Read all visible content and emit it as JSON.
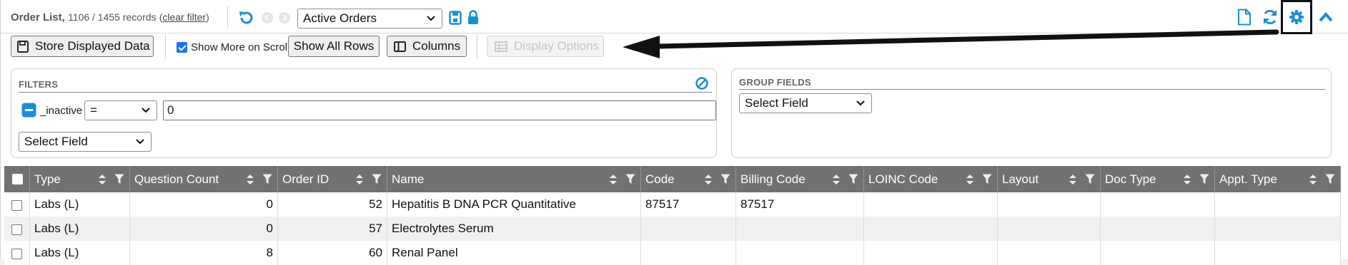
{
  "header": {
    "title": "Order List,",
    "record_count": "1106 / 1455 records",
    "clear_filter_label": "clear filter",
    "saved_view": "Active Orders"
  },
  "toolbar": {
    "store_label": "Store Displayed Data",
    "show_more_label": "Show More on Scroll",
    "show_more_checked": true,
    "show_all_rows_label": "Show All Rows",
    "columns_label": "Columns",
    "display_options_label": "Display Options"
  },
  "filters": {
    "title": "FILTERS",
    "rows": [
      {
        "field": "_inactive",
        "operator": "=",
        "value": "0"
      }
    ],
    "select_field_placeholder": "Select Field"
  },
  "group_fields": {
    "title": "GROUP FIELDS",
    "select_field_placeholder": "Select Field"
  },
  "grid": {
    "columns": [
      "Type",
      "Question Count",
      "Order ID",
      "Name",
      "Code",
      "Billing Code",
      "LOINC Code",
      "Layout",
      "Doc Type",
      "Appt. Type"
    ],
    "rows": [
      [
        "Labs (L)",
        "0",
        "52",
        "Hepatitis B DNA PCR Quantitative",
        "87517",
        "87517",
        "",
        "",
        "",
        ""
      ],
      [
        "Labs (L)",
        "0",
        "57",
        "Electrolytes Serum",
        "",
        "",
        "",
        "",
        "",
        ""
      ],
      [
        "Labs (L)",
        "8",
        "60",
        "Renal Panel",
        "",
        "",
        "",
        "",
        "",
        ""
      ]
    ]
  },
  "colors": {
    "accent": "#1a8fd6",
    "grid_header": "#717171",
    "row_alt": "#f1f1f4"
  }
}
